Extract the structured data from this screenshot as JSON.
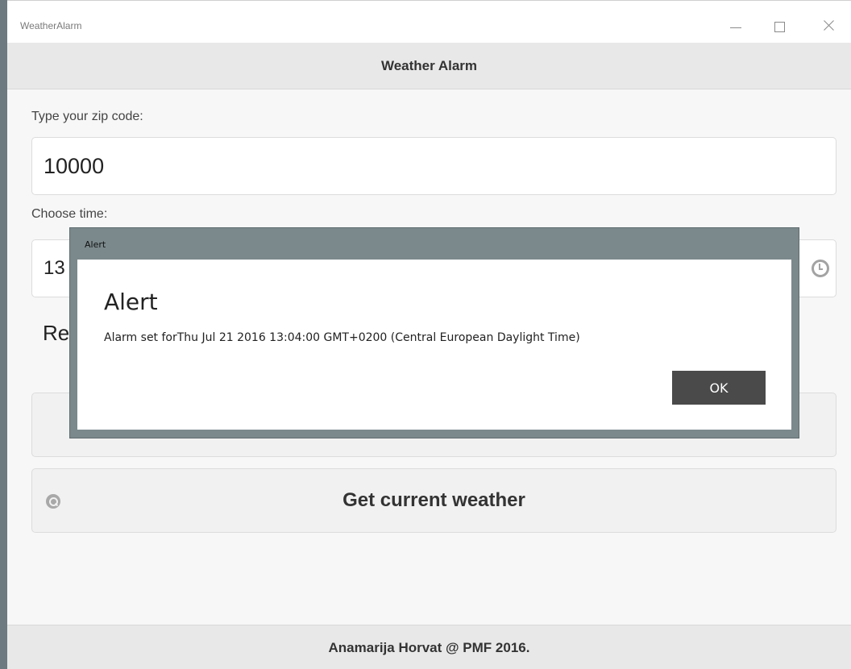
{
  "window": {
    "title": "WeatherAlarm",
    "controls": {
      "minimize": "minimize",
      "maximize": "maximize",
      "close": "close"
    }
  },
  "header": {
    "title": "Weather Alarm"
  },
  "form": {
    "zip_label": "Type your zip code:",
    "zip_value": "10000",
    "time_label": "Choose time:",
    "time_value": "13",
    "remaining_text": "Re"
  },
  "buttons": {
    "get_weather_label": "Get current weather",
    "get_weather_icon": "search-icon"
  },
  "footer": {
    "text": "Anamarija Horvat @ PMF 2016."
  },
  "dialog": {
    "window_title": "Alert",
    "heading": "Alert",
    "message": "Alarm set forThu Jul 21 2016 13:04:00 GMT+0200 (Central European Daylight Time)",
    "ok_label": "OK"
  },
  "colors": {
    "dialog_frame": "#7b898c",
    "ok_button": "#4a4a4a",
    "header_bg": "#e8e8e8"
  }
}
